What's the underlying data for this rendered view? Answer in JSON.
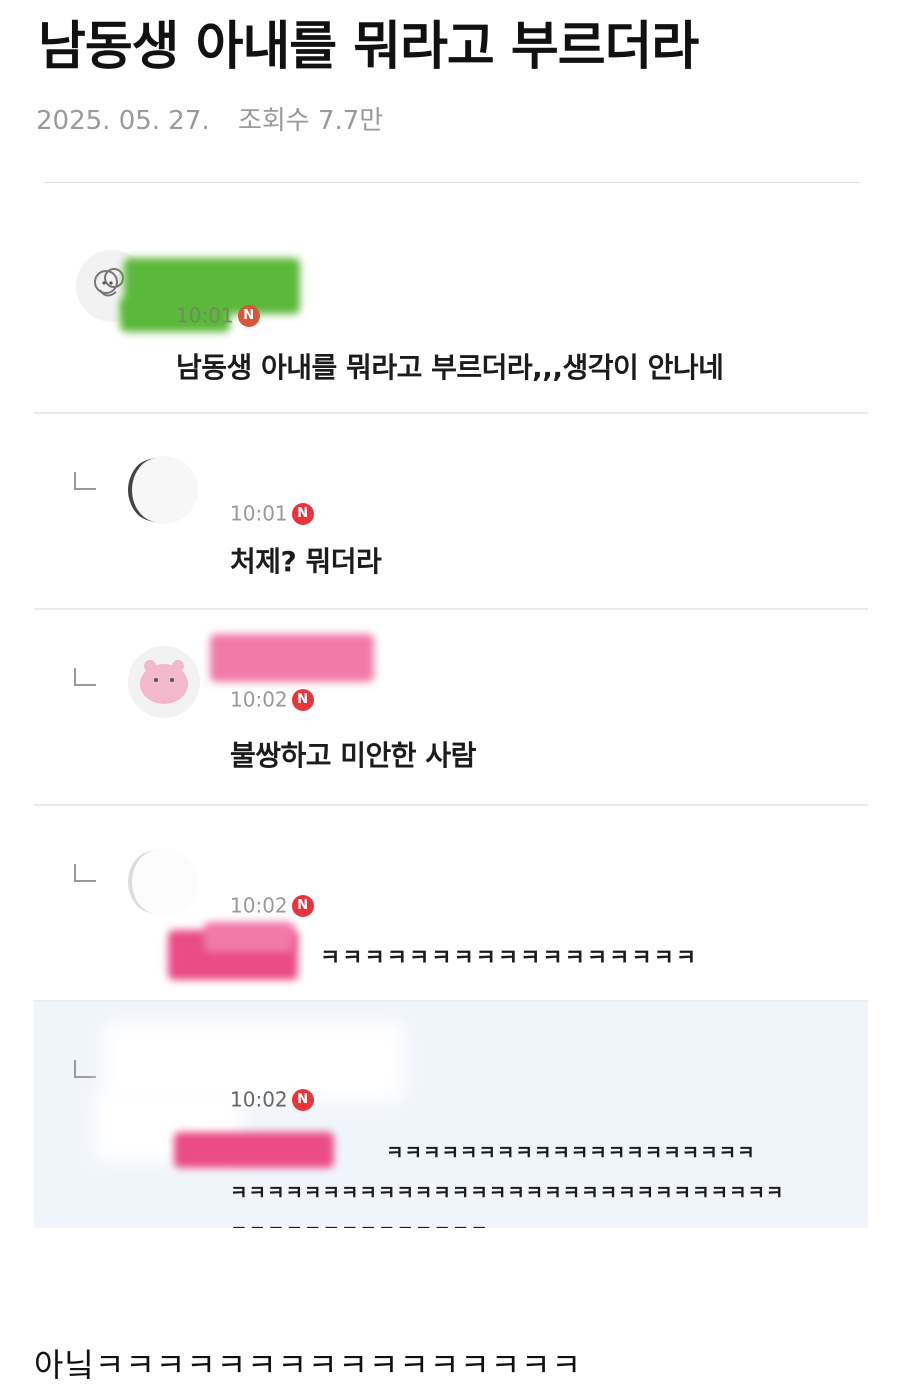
{
  "post": {
    "title": "남동생 아내를 뭐라고 부르더라",
    "date": "2025. 05. 27.",
    "views": "조회수 7.7만"
  },
  "comments": [
    {
      "time": "10:01",
      "badge": "N",
      "text": "남동생 아내를 뭐라고 부르더라,,,생각이 안나네",
      "avatar": "sheep-avatar"
    },
    {
      "time": "10:01",
      "badge": "N",
      "text": "처제? 뭐더라",
      "avatar": "moon-avatar"
    },
    {
      "time": "10:02",
      "badge": "N",
      "text": "불쌍하고 미안한 사람",
      "avatar": "hippo-avatar"
    },
    {
      "time": "10:02",
      "badge": "N",
      "text": "ㅋㅋㅋㅋㅋㅋㅋㅋㅋㅋㅋㅋㅋㅋㅋㅋㅋ",
      "avatar": "moon-avatar"
    },
    {
      "time": "10:02",
      "badge": "N",
      "lines": [
        "ㅋㅋㅋㅋㅋㅋㅋㅋㅋㅋㅋㅋㅋㅋㅋㅋㅋㅋㅋㅋ",
        "ㅋㅋㅋㅋㅋㅋㅋㅋㅋㅋㅋㅋㅋㅋㅋㅋㅋㅋㅋㅋㅋㅋㅋㅋㅋㅋㅋㅋㅋㅋ",
        "ㅋㅋㅋㅋㅋㅋㅋㅋㅋㅋㅋㅋㅋㅋ"
      ]
    }
  ],
  "caption": "아닠ㅋㅋㅋㅋㅋㅋㅋㅋㅋㅋㅋㅋㅋㅋㅋㅋ",
  "colors": {
    "badge": "#e8343a",
    "highlight": "#f0f5fc",
    "censor_green": "#5cb83a",
    "censor_pink": "#f07aa8"
  }
}
